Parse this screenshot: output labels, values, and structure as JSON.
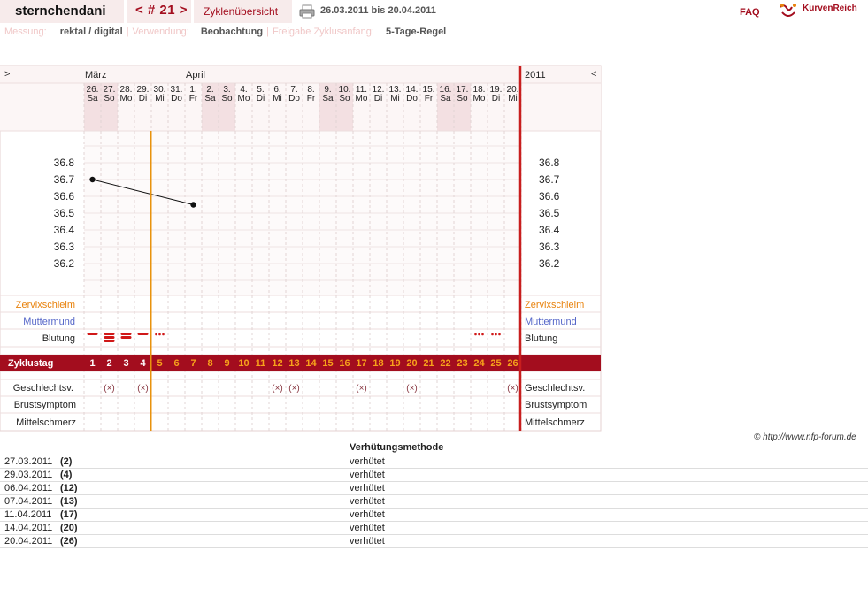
{
  "header": {
    "username": "sternchendani",
    "cycle_nav": "< # 21 >",
    "overview_tab": "Zyklenübersicht",
    "date_range": "26.03.2011 bis 20.04.2011",
    "faq": "FAQ",
    "logo_text": "KurvenReich",
    "print_icon": "printer-icon",
    "logo_icon": "curve-logo-icon"
  },
  "meta": {
    "measurement_label": "Messung:",
    "measurement_value": "rektal / digital",
    "usage_label": "Verwendung:",
    "usage_value": "Beobachtung",
    "release_label": "Freigabe Zyklusanfang:",
    "release_value": "5-Tage-Regel"
  },
  "colors": {
    "accent": "#a30d1e",
    "header_bg": "#f7ebeb",
    "weekend_bg": "#f3e0e2",
    "cervix": "#e8820c",
    "muttermund": "#5566c8",
    "ovulation_line": "#e8920c",
    "current_day_line": "#c81e1e"
  },
  "chart_data": {
    "type": "line",
    "nav_prev": ">",
    "nav_next": "<",
    "year": "2011",
    "months": [
      {
        "label": "März",
        "start_index": 0
      },
      {
        "label": "April",
        "start_index": 6
      }
    ],
    "days": [
      {
        "d": "26.",
        "w": "Sa",
        "weekend": true
      },
      {
        "d": "27.",
        "w": "So",
        "weekend": true
      },
      {
        "d": "28.",
        "w": "Mo",
        "weekend": false
      },
      {
        "d": "29.",
        "w": "Di",
        "weekend": false
      },
      {
        "d": "30.",
        "w": "Mi",
        "weekend": false
      },
      {
        "d": "31.",
        "w": "Do",
        "weekend": false
      },
      {
        "d": "1.",
        "w": "Fr",
        "weekend": false
      },
      {
        "d": "2.",
        "w": "Sa",
        "weekend": true
      },
      {
        "d": "3.",
        "w": "So",
        "weekend": true
      },
      {
        "d": "4.",
        "w": "Mo",
        "weekend": false
      },
      {
        "d": "5.",
        "w": "Di",
        "weekend": false
      },
      {
        "d": "6.",
        "w": "Mi",
        "weekend": false
      },
      {
        "d": "7.",
        "w": "Do",
        "weekend": false
      },
      {
        "d": "8.",
        "w": "Fr",
        "weekend": false
      },
      {
        "d": "9.",
        "w": "Sa",
        "weekend": true
      },
      {
        "d": "10.",
        "w": "So",
        "weekend": true
      },
      {
        "d": "11.",
        "w": "Mo",
        "weekend": false
      },
      {
        "d": "12.",
        "w": "Di",
        "weekend": false
      },
      {
        "d": "13.",
        "w": "Mi",
        "weekend": false
      },
      {
        "d": "14.",
        "w": "Do",
        "weekend": false
      },
      {
        "d": "15.",
        "w": "Fr",
        "weekend": false
      },
      {
        "d": "16.",
        "w": "Sa",
        "weekend": true
      },
      {
        "d": "17.",
        "w": "So",
        "weekend": true
      },
      {
        "d": "18.",
        "w": "Mo",
        "weekend": false
      },
      {
        "d": "19.",
        "w": "Di",
        "weekend": false
      },
      {
        "d": "20.",
        "w": "Mi",
        "weekend": false
      }
    ],
    "y_ticks": [
      "36.8",
      "36.7",
      "36.6",
      "36.5",
      "36.4",
      "36.3",
      "36.2"
    ],
    "ylim": [
      36.1,
      36.9
    ],
    "series": [
      {
        "values": [
          {
            "day_index": 0,
            "temp": 36.7
          },
          {
            "day_index": 6,
            "temp": 36.55
          }
        ]
      }
    ],
    "ovulation_after_day_index": 3,
    "row_labels": {
      "cervix": "Zervixschleim",
      "muttermund": "Muttermund",
      "bleeding": "Blutung",
      "cycle_day": "Zyklustag",
      "intercourse": "Geschlechtsv.",
      "breast": "Brustsymptom",
      "midpain": "Mittelschmerz"
    },
    "bleeding": [
      {
        "day_index": 0,
        "level": "light"
      },
      {
        "day_index": 1,
        "level": "heavy"
      },
      {
        "day_index": 2,
        "level": "medium"
      },
      {
        "day_index": 3,
        "level": "light"
      },
      {
        "day_index": 4,
        "level": "spotting"
      },
      {
        "day_index": 23,
        "level": "spotting"
      },
      {
        "day_index": 24,
        "level": "spotting"
      }
    ],
    "cycle_days": [
      "1",
      "2",
      "3",
      "4",
      "5",
      "6",
      "7",
      "8",
      "9",
      "10",
      "11",
      "12",
      "13",
      "14",
      "15",
      "16",
      "17",
      "18",
      "19",
      "20",
      "21",
      "22",
      "23",
      "24",
      "25",
      "26"
    ],
    "intercourse_mark": "(×)",
    "intercourse_days": [
      1,
      3,
      11,
      12,
      16,
      19,
      25
    ]
  },
  "footer_credit": "© http://www.nfp-forum.de",
  "method_table": {
    "header": "Verhütungsmethode",
    "rows": [
      {
        "date": "27.03.2011",
        "num": "(2)",
        "method": "verhütet"
      },
      {
        "date": "29.03.2011",
        "num": "(4)",
        "method": "verhütet"
      },
      {
        "date": "06.04.2011",
        "num": "(12)",
        "method": "verhütet"
      },
      {
        "date": "07.04.2011",
        "num": "(13)",
        "method": "verhütet"
      },
      {
        "date": "11.04.2011",
        "num": "(17)",
        "method": "verhütet"
      },
      {
        "date": "14.04.2011",
        "num": "(20)",
        "method": "verhütet"
      },
      {
        "date": "20.04.2011",
        "num": "(26)",
        "method": "verhütet"
      }
    ]
  }
}
